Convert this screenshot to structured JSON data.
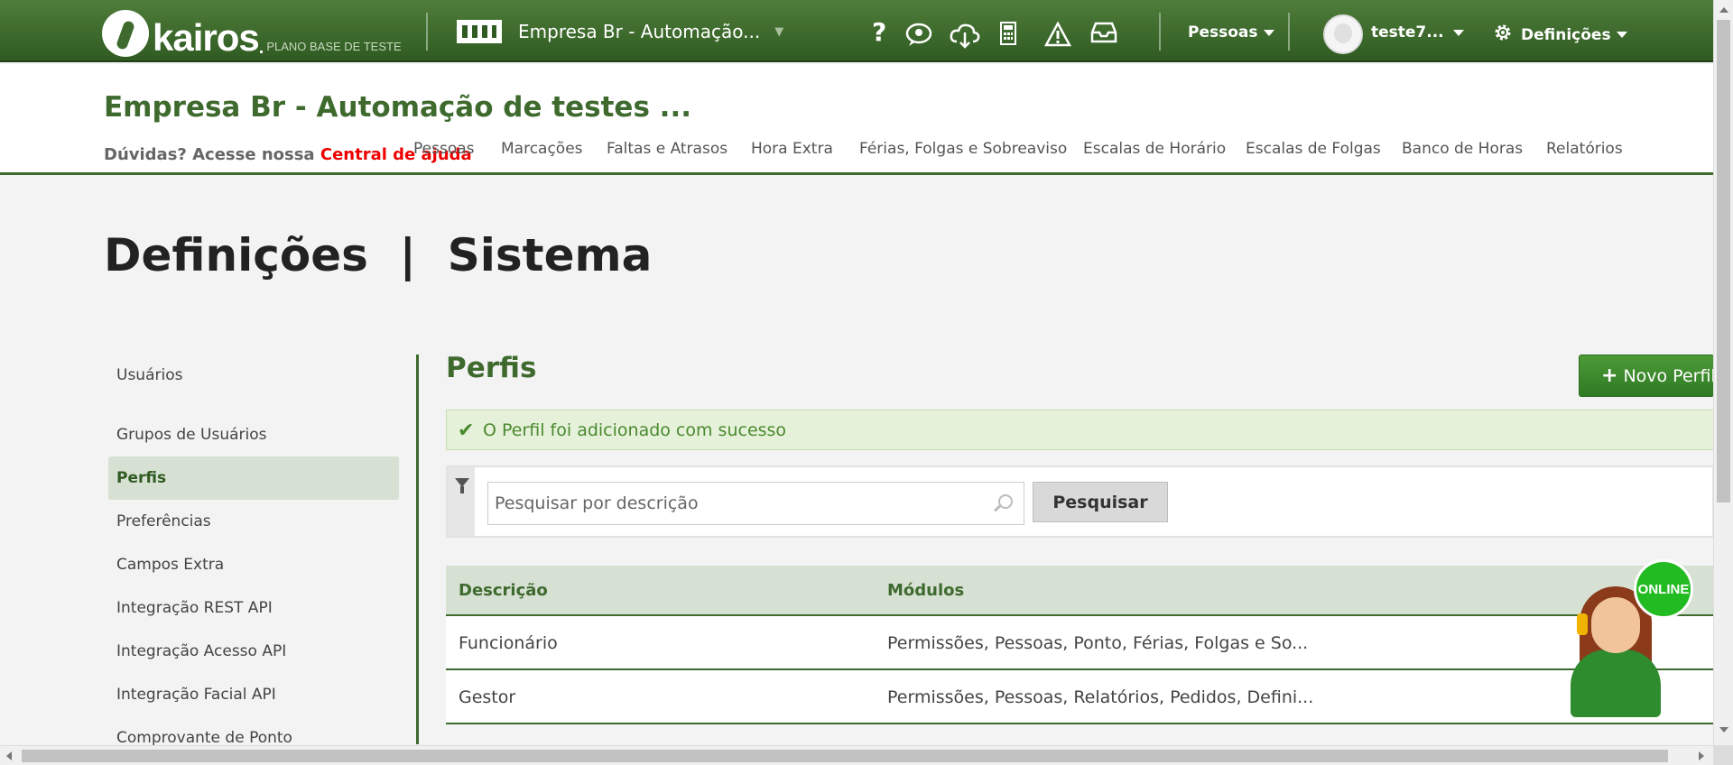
{
  "topbar": {
    "logo_text": "kairos",
    "logo_dot": ".",
    "plan": "PLANO BASE DE TESTE",
    "company_selector": "Empresa Br - Automação...",
    "icons": [
      "help-icon",
      "chat-icon",
      "cloud-download-icon",
      "calculator-icon",
      "warning-icon",
      "inbox-icon"
    ],
    "help_glyph": "?",
    "pessoas_menu": "Pessoas",
    "user_menu": "teste7...",
    "definicoes_menu": "Definições",
    "accent_color": "#3e6a2e"
  },
  "header": {
    "company_title": "Empresa Br - Automação de testes ...",
    "help_prefix": "Dúvidas? Acesse nossa ",
    "help_link": "Central de ajuda",
    "nav": [
      "Pessoas",
      "Marcações",
      "Faltas e Atrasos",
      "Hora Extra",
      "Férias, Folgas e Sobreaviso",
      "Escalas de Horário",
      "Escalas de Folgas",
      "Banco de Horas",
      "Relatórios"
    ]
  },
  "page_title": "Definições  |  Sistema",
  "sidebar": {
    "items": [
      {
        "label": "Usuários"
      },
      {
        "label": "Grupos de Usuários"
      },
      {
        "label": "Perfis",
        "active": true
      },
      {
        "label": "Preferências"
      },
      {
        "label": "Campos Extra"
      },
      {
        "label": "Integração REST API"
      },
      {
        "label": "Integração Acesso API"
      },
      {
        "label": "Integração Facial API"
      },
      {
        "label": "Comprovante de Ponto"
      }
    ]
  },
  "main": {
    "title": "Perfis",
    "new_button": "Novo Perfil",
    "alert": "O Perfil foi adicionado com sucesso",
    "search_placeholder": "Pesquisar por descrição",
    "search_button": "Pesquisar",
    "table": {
      "headers": [
        "Descrição",
        "Módulos"
      ],
      "rows": [
        [
          "Funcionário",
          "Permissões, Pessoas, Ponto, Férias, Folgas e So..."
        ],
        [
          "Gestor",
          "Permissões, Pessoas, Relatórios, Pedidos, Defini..."
        ]
      ]
    }
  },
  "chat_widget": {
    "badge": "ONLINE"
  }
}
